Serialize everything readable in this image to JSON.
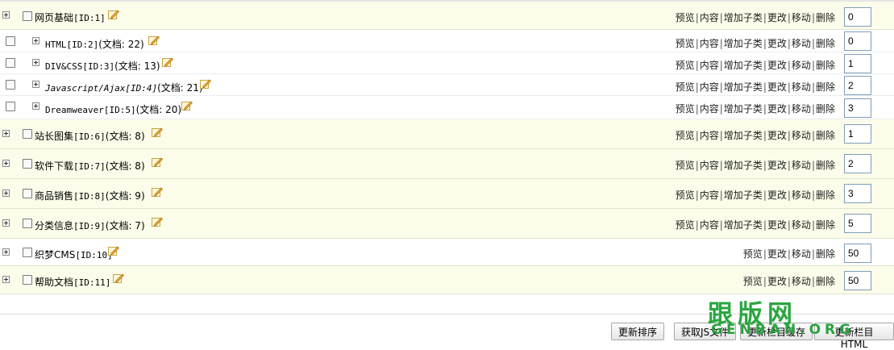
{
  "categories": [
    {
      "expanded": true,
      "name": "网页基础",
      "code": "[ID:1]",
      "doc": "",
      "actions": [
        "预览",
        "内容",
        "增加子类",
        "更改",
        "移动",
        "删除"
      ],
      "order": "0"
    },
    {
      "child": true,
      "name": "HTML[ID:2]",
      "doc": "(文档: 22)",
      "actions": [
        "预览",
        "内容",
        "增加子类",
        "更改",
        "移动",
        "删除"
      ],
      "order": "0"
    },
    {
      "child": true,
      "name": "DIV&CSS[ID:3]",
      "doc": "(文档: 13)",
      "actions": [
        "预览",
        "内容",
        "增加子类",
        "更改",
        "移动",
        "删除"
      ],
      "order": "1"
    },
    {
      "child": true,
      "name": "Javascript/Ajax[ID:4]",
      "doc": "(文档: 21)",
      "actions": [
        "预览",
        "内容",
        "增加子类",
        "更改",
        "移动",
        "删除"
      ],
      "order": "2"
    },
    {
      "child": true,
      "name": "Dreamweaver[ID:5]",
      "doc": "(文档: 20)",
      "actions": [
        "预览",
        "内容",
        "增加子类",
        "更改",
        "移动",
        "删除"
      ],
      "order": "3"
    },
    {
      "name": "站长图集",
      "code": "[ID:6]",
      "doc": "(文档: 8)",
      "actions": [
        "预览",
        "内容",
        "增加子类",
        "更改",
        "移动",
        "删除"
      ],
      "order": "1"
    },
    {
      "name": "软件下载",
      "code": "[ID:7]",
      "doc": "(文档: 8)",
      "actions": [
        "预览",
        "内容",
        "增加子类",
        "更改",
        "移动",
        "删除"
      ],
      "order": "2"
    },
    {
      "name": "商品销售",
      "code": "[ID:8]",
      "doc": "(文档: 9)",
      "actions": [
        "预览",
        "内容",
        "增加子类",
        "更改",
        "移动",
        "删除"
      ],
      "order": "3"
    },
    {
      "name": "分类信息",
      "code": "[ID:9]",
      "doc": "(文档: 7)",
      "actions": [
        "预览",
        "内容",
        "增加子类",
        "更改",
        "移动",
        "删除"
      ],
      "order": "5"
    },
    {
      "name": "织梦CMS",
      "code": "[ID:10]",
      "doc": "",
      "actions": [
        "预览",
        "更改",
        "移动",
        "删除"
      ],
      "order": "50"
    },
    {
      "name": "帮助文档",
      "code": "[ID:11]",
      "doc": "",
      "actions": [
        "预览",
        "更改",
        "移动",
        "删除"
      ],
      "order": "50"
    }
  ],
  "buttons": {
    "update_order": "更新排序",
    "get_js": "获取JS文件",
    "update_cache": "更新栏目缓存",
    "update_list": "更新栏目HTML"
  },
  "watermark": {
    "brand_cn": "跟版网",
    "brand_en": "GENBAN.ORG"
  }
}
